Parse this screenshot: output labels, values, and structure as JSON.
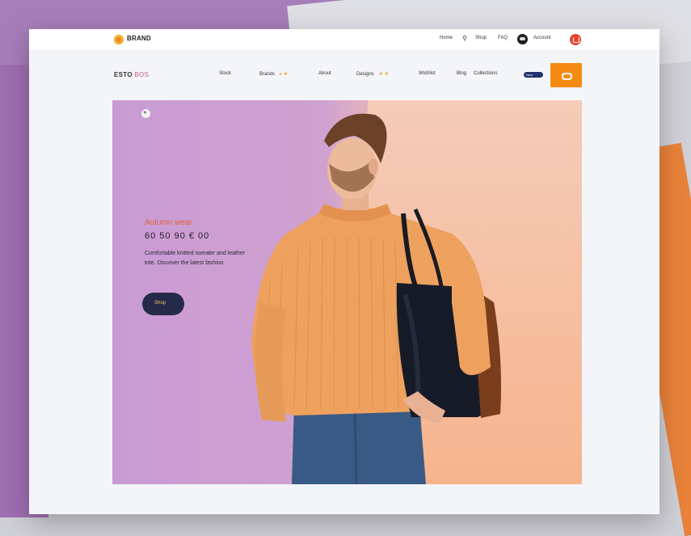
{
  "topbar": {
    "logo": "BRAND",
    "links": [
      "Home",
      "Shop",
      "FAQ"
    ],
    "search_icon": "search-icon",
    "user": "Account",
    "cart_icon": "bag-icon"
  },
  "nav": {
    "brand_main": "ESTO",
    "brand_accent": "BOS",
    "items": [
      "Stock",
      "Brands",
      "About",
      "Designs",
      "Wishlist",
      "Blog"
    ],
    "extra": "Collections",
    "badge": "New",
    "cta_icon": "search-icon"
  },
  "hero": {
    "close_icon": "close-icon",
    "eyebrow": "Autumn wear",
    "price": "60 50 90 € 00",
    "description": "Comfortable knitted sweater and leather tote. Discover the latest fashion",
    "button_label": "Shop",
    "colors": {
      "left": "#c99bd4",
      "right": "#f6b895",
      "button": "#262a4a",
      "accent": "#e0613a"
    }
  }
}
